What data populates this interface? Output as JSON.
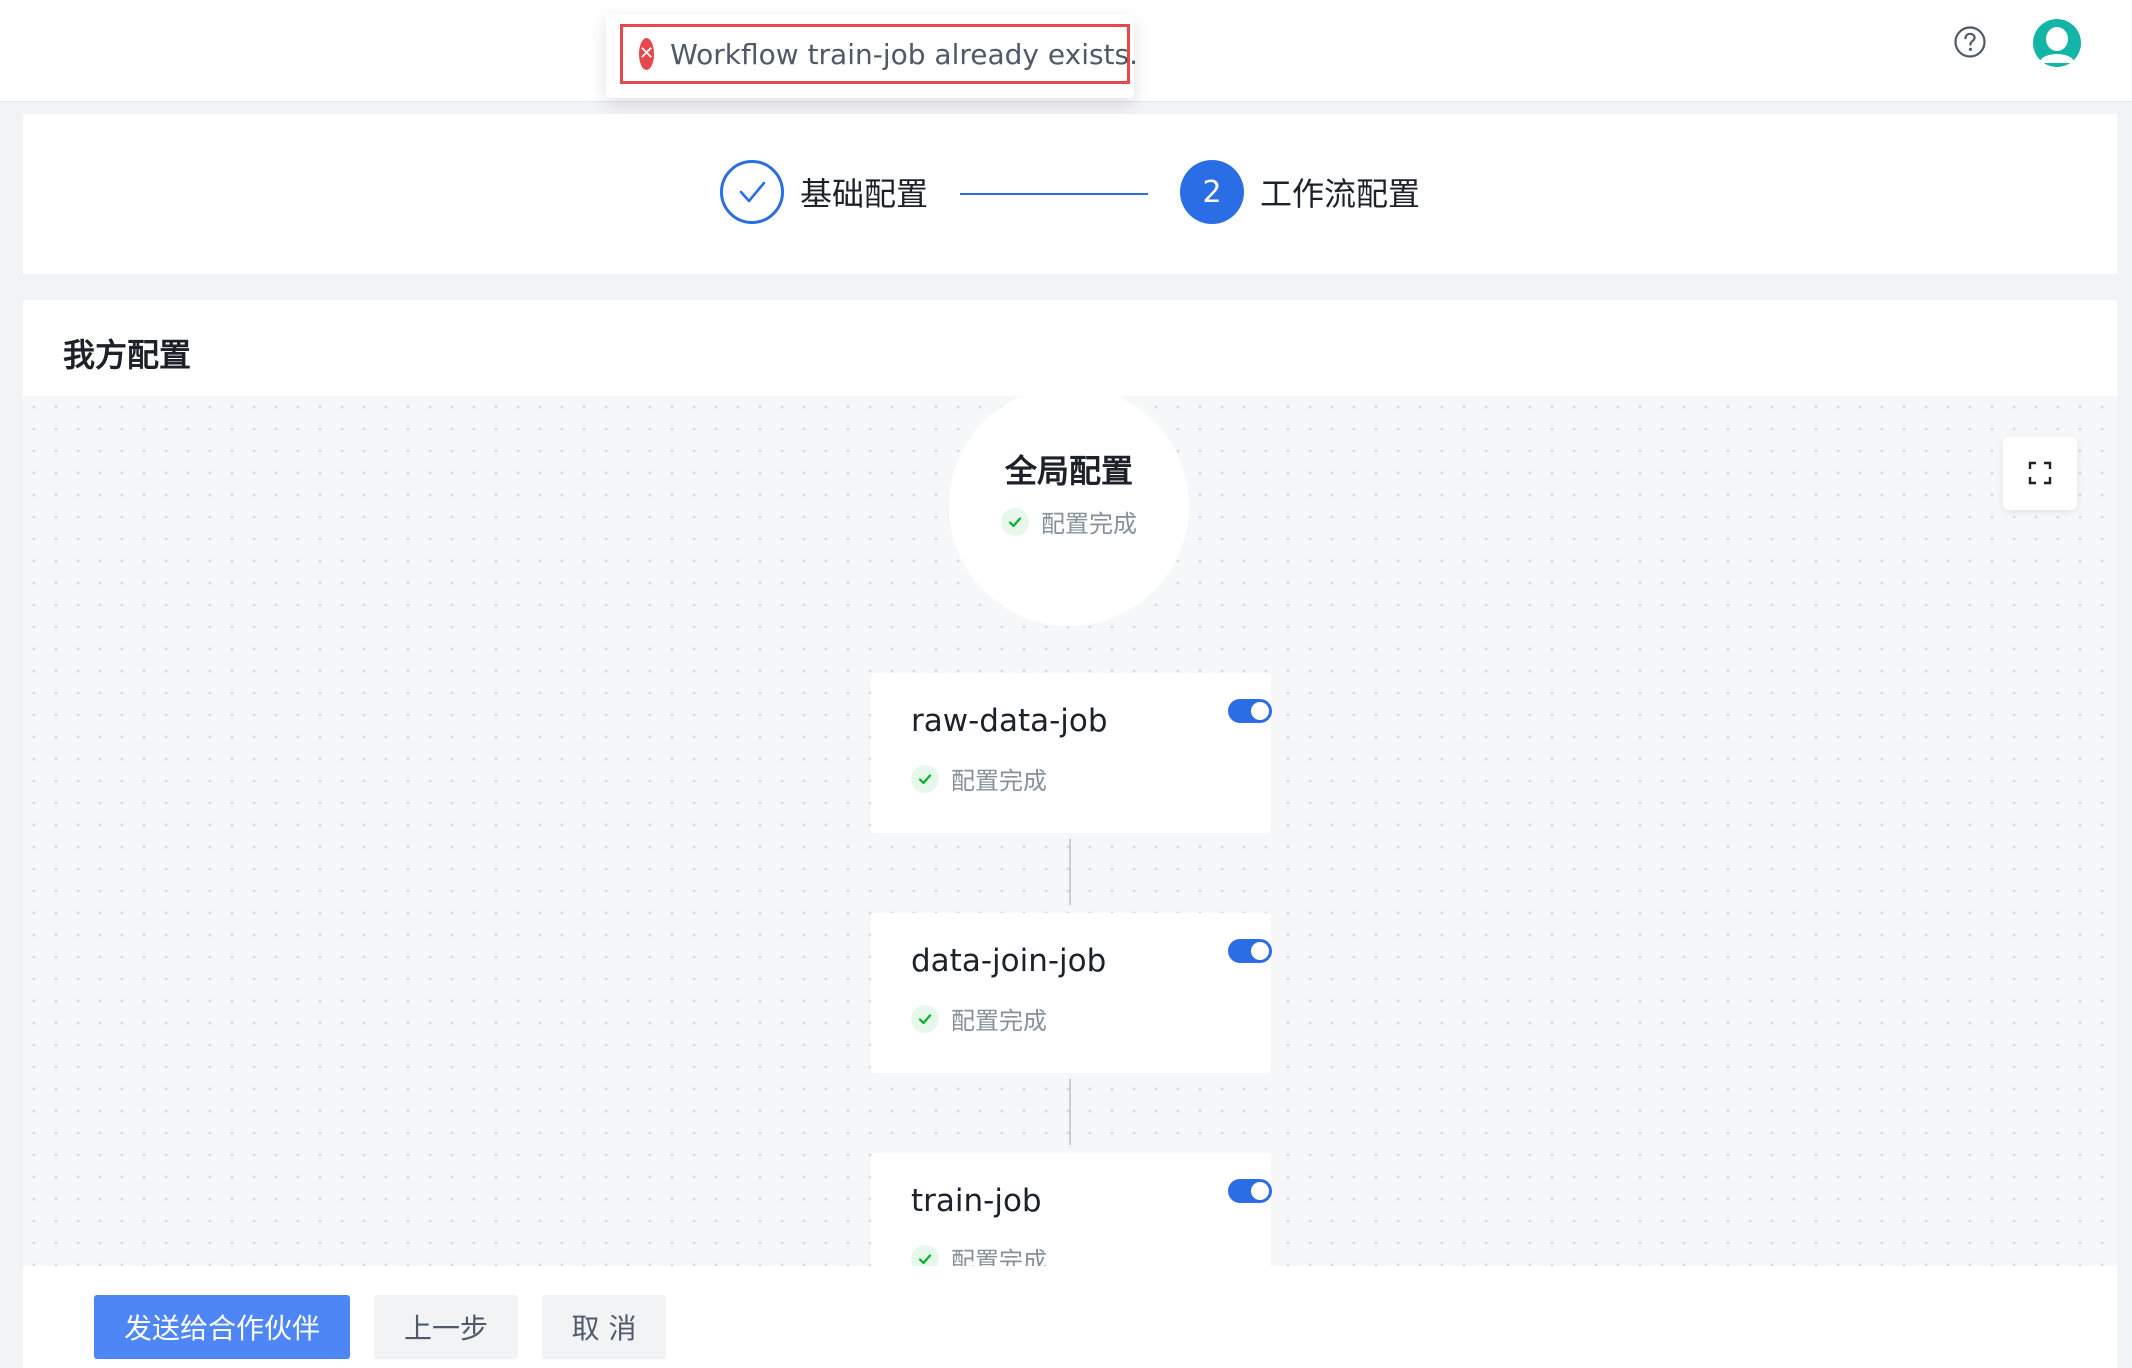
{
  "toast": {
    "message": "Workflow train-job already exists.",
    "icon": "error-icon",
    "color": "#e5484d"
  },
  "header": {
    "help_icon": "question-circle-icon",
    "avatar_icon": "user-avatar-icon",
    "avatar_color": "#12b5a6"
  },
  "steps": [
    {
      "label": "基础配置",
      "state": "done"
    },
    {
      "number": "2",
      "label": "工作流配置",
      "state": "active"
    }
  ],
  "section": {
    "title": "我方配置"
  },
  "canvas": {
    "global_node": {
      "title": "全局配置",
      "status": "配置完成"
    },
    "jobs": [
      {
        "name": "raw-data-job",
        "status": "配置完成",
        "enabled": true
      },
      {
        "name": "data-join-job",
        "status": "配置完成",
        "enabled": true
      },
      {
        "name": "train-job",
        "status": "配置完成",
        "enabled": true
      }
    ],
    "fullscreen_icon": "fullscreen-icon"
  },
  "footer": {
    "send_label": "发送给合作伙伴",
    "prev_label": "上一步",
    "cancel_label": "取 消"
  },
  "colors": {
    "primary": "#2b6de5",
    "success": "#00b42a"
  }
}
